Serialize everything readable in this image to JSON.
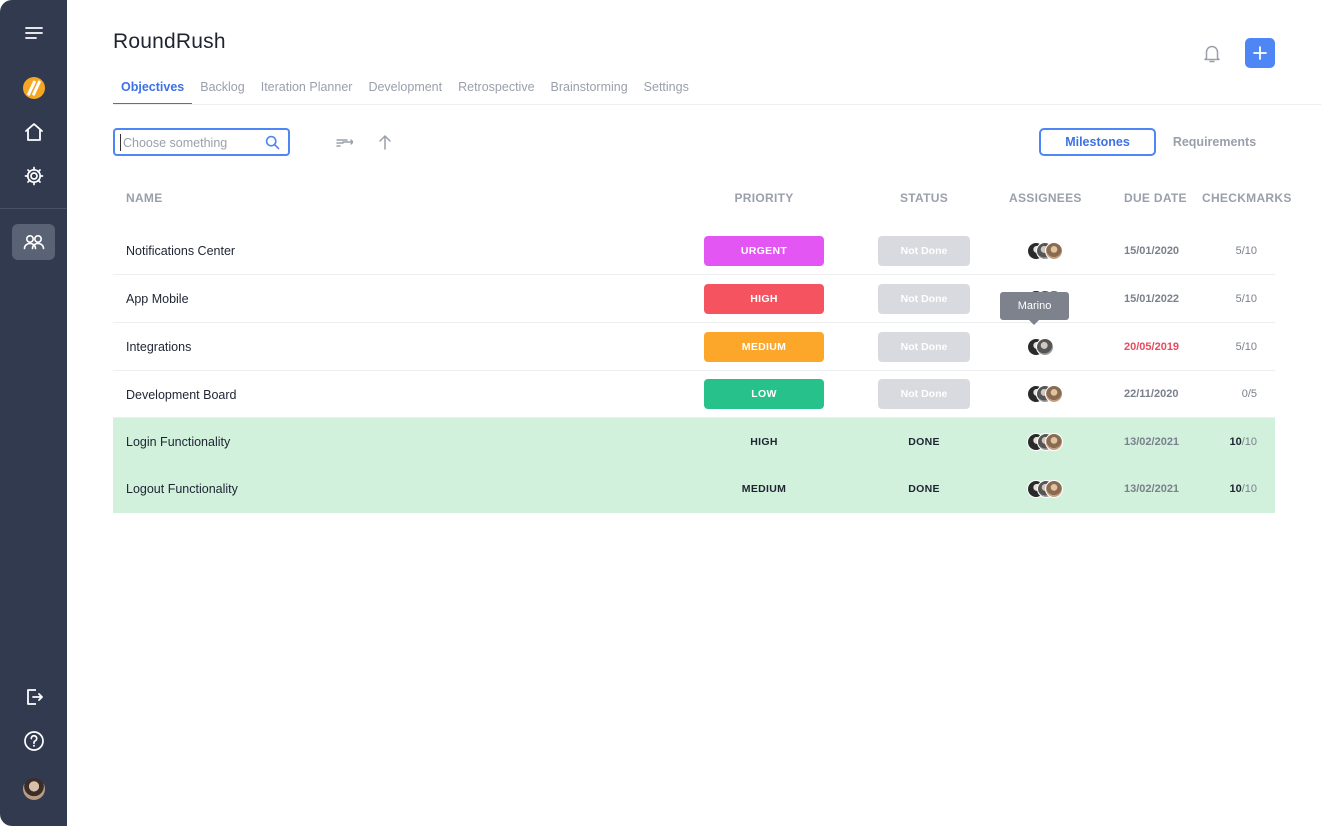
{
  "sidebar": {
    "icons": [
      "menu-icon",
      "logo-icon",
      "home-icon",
      "gear-icon",
      "team-icon",
      "logout-icon",
      "help-icon",
      "user-avatar"
    ]
  },
  "header": {
    "title": "RoundRush"
  },
  "tabs": [
    {
      "label": "Objectives",
      "active": true
    },
    {
      "label": "Backlog",
      "active": false
    },
    {
      "label": "Iteration Planner",
      "active": false
    },
    {
      "label": "Development",
      "active": false
    },
    {
      "label": "Retrospective",
      "active": false
    },
    {
      "label": "Brainstorming",
      "active": false
    },
    {
      "label": "Settings",
      "active": false
    }
  ],
  "search": {
    "placeholder": "Choose something",
    "value": ""
  },
  "view_toggle": {
    "milestones": "Milestones",
    "requirements": "Requirements",
    "selected": "Milestones"
  },
  "table": {
    "headers": {
      "name": "NAME",
      "priority": "PRIORITY",
      "status": "STATUS",
      "assignees": "ASSIGNEES",
      "due_date": "DUE DATE",
      "checkmarks": "CHECKMARKS"
    },
    "rows": [
      {
        "name": "Notifications Center",
        "priority": "URGENT",
        "status": "Not Done",
        "due": "15/01/2020",
        "checked": "5",
        "total": "/10",
        "overdue": false,
        "done": false
      },
      {
        "name": "App Mobile",
        "priority": "HIGH",
        "status": "Not Done",
        "due": "15/01/2022",
        "checked": "5",
        "total": "/10",
        "overdue": false,
        "done": false
      },
      {
        "name": "Integrations",
        "priority": "MEDIUM",
        "status": "Not Done",
        "due": "20/05/2019",
        "checked": "5",
        "total": "/10",
        "overdue": true,
        "done": false
      },
      {
        "name": "Development Board",
        "priority": "LOW",
        "status": "Not Done",
        "due": "22/11/2020",
        "checked": "0",
        "total": "/5",
        "overdue": false,
        "done": false
      },
      {
        "name": "Login Functionality",
        "priority": "HIGH",
        "status": "DONE",
        "due": "13/02/2021",
        "checked": "10",
        "total": "/10",
        "overdue": false,
        "done": true
      },
      {
        "name": "Logout Functionality",
        "priority": "MEDIUM",
        "status": "DONE",
        "due": "13/02/2021",
        "checked": "10",
        "total": "/10",
        "overdue": false,
        "done": true
      }
    ]
  },
  "tooltip": {
    "text": "Marino"
  },
  "colors": {
    "sidebar_bg": "#323a50",
    "accent": "#4e87f5",
    "urgent": "#e356f3",
    "high": "#f4535f",
    "medium": "#fca62a",
    "low": "#27c18c",
    "done_row": "#d1f1dc",
    "overdue": "#e84b5f"
  }
}
